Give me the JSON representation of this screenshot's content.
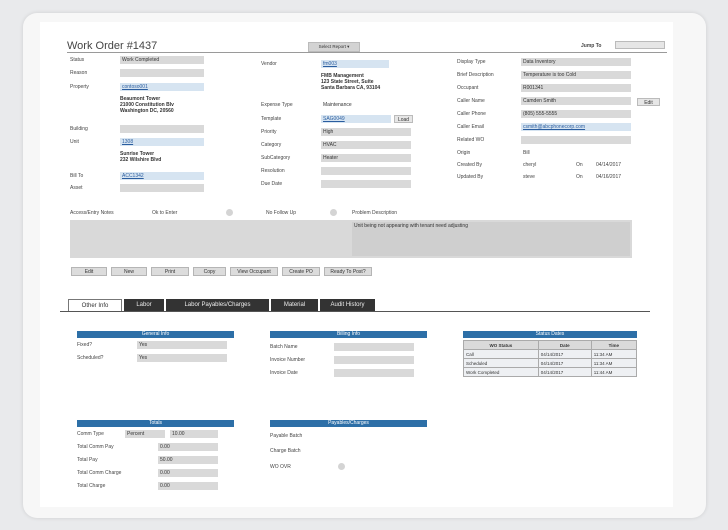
{
  "window_title": "Work Order #1437",
  "report_dropdown": "Select Report",
  "jump_to_label": "Jump To",
  "left_col": {
    "status_label": "Status",
    "status_value": "Work Completed",
    "reason_label": "Reason",
    "property_label": "Property",
    "property_value": "contoso001",
    "property_address": [
      "Beaumont Tower",
      "21000 Constitution Blv",
      "Washington DC, 20560"
    ],
    "building_label": "Building",
    "unit_label": "Unit",
    "unit_value": "1308",
    "unit_address": [
      "Sunrise Tower",
      "232 Wilshire Blvd"
    ],
    "bill_to_label": "Bill To",
    "bill_to_value": "ACC1342",
    "asset_label": "Asset"
  },
  "mid_col": {
    "vendor_label": "Vendor",
    "vendor_value": "fm003",
    "vendor_address": [
      "FMB Management",
      "123 State Street, Suite",
      "Santa Barbara CA, 93104"
    ],
    "expense_type_label": "Expense Type",
    "expense_type_value": "Maintenance",
    "template_label": "Template",
    "template_value": "SAG0049",
    "load_button": "Load",
    "priority_label": "Priority",
    "priority_value": "High",
    "category_label": "Category",
    "category_value": "HVAC",
    "subcategory_label": "SubCategory",
    "subcategory_value": "Heater",
    "resolution_label": "Resolution",
    "due_date_label": "Due Date"
  },
  "right_col": {
    "display_type_label": "Display Type",
    "display_type_value": "Data Inventory",
    "brief_desc_label": "Brief Description",
    "brief_desc_value": "Temperature is too Cold",
    "occupant_label": "Occupant",
    "occupant_value": "R001341",
    "caller_name_label": "Caller Name",
    "caller_name_value": "Camden Smith",
    "edit_button": "Edit",
    "caller_phone_label": "Caller Phone",
    "caller_phone_value": "(805) 555-5555",
    "caller_email_label": "Caller Email",
    "caller_email_value": "csmith@abcphonecorp.com",
    "related_wo_label": "Related WO",
    "origin_label": "Origin",
    "origin_value": "Bill",
    "created_by_label": "Created By",
    "created_by_value": "cheryl",
    "created_on_label": "On",
    "created_on_value": "04/14/2017",
    "updated_by_label": "Updated By",
    "updated_by_value": "steve",
    "updated_on_label": "On",
    "updated_on_value": "04/16/2017"
  },
  "notes": {
    "access_label": "Access/Entry Notes",
    "ok_to_enter_label": "Ok to Enter",
    "no_follow_up_label": "No Follow Up",
    "problem_desc_label": "Problem Description",
    "problem_desc_value": "Unit being not appearing with tenant need adjusting"
  },
  "buttons": [
    "Edit",
    "New",
    "Print",
    "Copy",
    "View Occupant",
    "Create PO",
    "Ready To Post?"
  ],
  "tabs": [
    "Other Info",
    "Labor",
    "Labor Payables/Charges",
    "Material",
    "Audit History"
  ],
  "general_info": {
    "header": "General Info",
    "fixed_label": "Fixed?",
    "fixed_value": "Yes",
    "scheduled_label": "Scheduled?",
    "scheduled_value": "Yes"
  },
  "billing_info": {
    "header": "Billing Info",
    "batch_label": "Batch Name",
    "invoice_number_label": "Invoice Number",
    "invoice_date_label": "Invoice Date"
  },
  "status_dates": {
    "header": "Status Dates",
    "columns": [
      "WO Status",
      "Date",
      "Time"
    ],
    "rows": [
      [
        "Call",
        "04/14/2017",
        "11:34 AM"
      ],
      [
        "Scheduled",
        "04/14/2017",
        "11:34 AM"
      ],
      [
        "Work Completed",
        "04/14/2017",
        "11:44 AM"
      ]
    ]
  },
  "totals": {
    "header": "Totals",
    "comm_type_label": "Comm Type",
    "comm_type_value": "Percent",
    "comm_type_amount": "10.00",
    "total_comm_pay_label": "Total Comm Pay",
    "total_comm_pay_value": "0.00",
    "total_pay_label": "Total Pay",
    "total_pay_value": "50.00",
    "total_comm_charge_label": "Total Comm Charge",
    "total_comm_charge_value": "0.00",
    "total_charge_label": "Total Charge",
    "total_charge_value": "0.00"
  },
  "payables": {
    "header": "Payables/Charges",
    "payable_batch_label": "Payable Batch",
    "charge_batch_label": "Charge Batch",
    "wo_ovr_label": "WO OVR"
  }
}
